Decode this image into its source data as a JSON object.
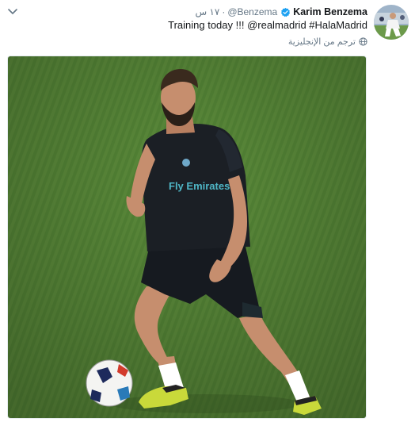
{
  "tweet": {
    "display_name": "Karim Benzema",
    "handle": "@Benzema",
    "separator": "·",
    "timestamp": "١٧ س",
    "text": "Training today !!! @realmadrid #HalaMadrid",
    "translate_label": "ترجم من الإنجليزية",
    "verified": true
  },
  "photo": {
    "shirt_text": "Fly Emirates"
  },
  "colors": {
    "verified_blue": "#1da1f2",
    "link_color": "#14171a",
    "muted": "#657786",
    "grass": "#5a8a3a"
  },
  "icons": {
    "menu": "chevron-down-icon",
    "verified": "verified-badge-icon",
    "translate": "globe-icon"
  }
}
